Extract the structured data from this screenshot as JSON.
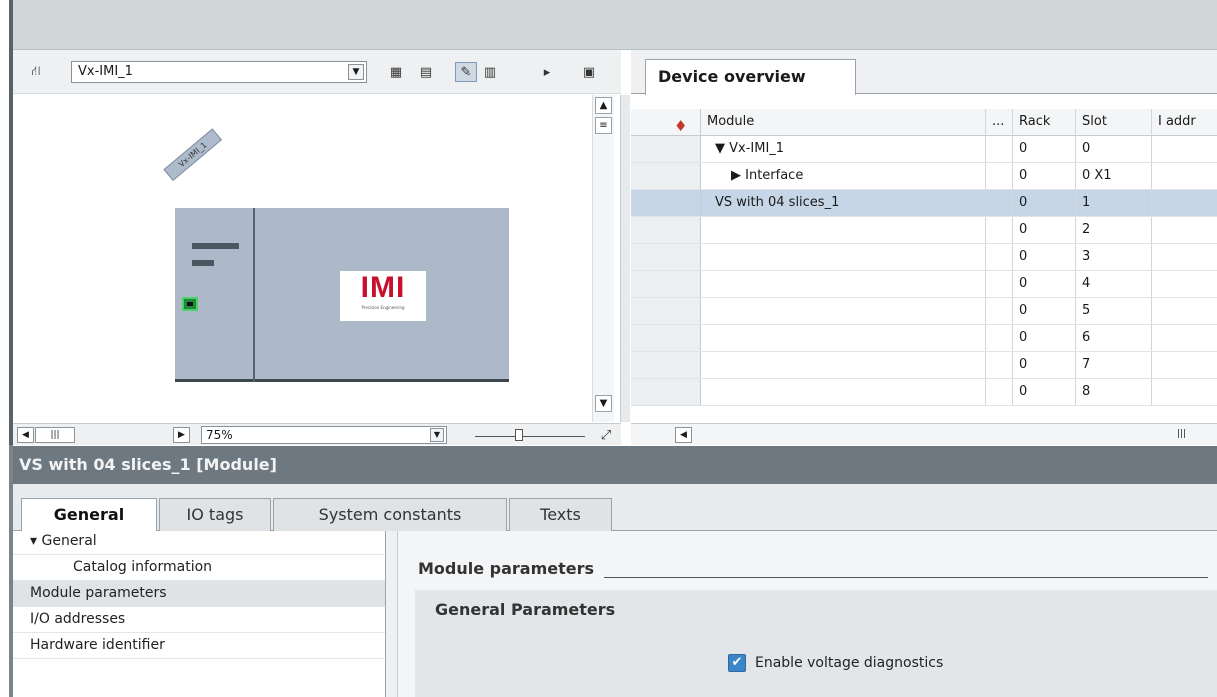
{
  "device_view": {
    "device_select": "Vx-IMI_1",
    "module_tag": "Vx-IMI_1",
    "logo_text": "IMI",
    "logo_subtext": "Precision Engineering",
    "zoom": "75%"
  },
  "device_overview": {
    "tab_label": "Device overview",
    "columns": [
      "Module",
      "...",
      "Rack",
      "Slot",
      "I addr"
    ],
    "rows": [
      {
        "module": "▼ Vx-IMI_1",
        "rack": "0",
        "slot": "0",
        "indent": 1
      },
      {
        "module": "▶ Interface",
        "rack": "0",
        "slot": "0 X1",
        "indent": 2
      },
      {
        "module": "VS with 04 slices_1",
        "rack": "0",
        "slot": "1",
        "indent": 1,
        "selected": true
      },
      {
        "module": "",
        "rack": "0",
        "slot": "2"
      },
      {
        "module": "",
        "rack": "0",
        "slot": "3"
      },
      {
        "module": "",
        "rack": "0",
        "slot": "4"
      },
      {
        "module": "",
        "rack": "0",
        "slot": "5"
      },
      {
        "module": "",
        "rack": "0",
        "slot": "6"
      },
      {
        "module": "",
        "rack": "0",
        "slot": "7"
      },
      {
        "module": "",
        "rack": "0",
        "slot": "8"
      }
    ]
  },
  "properties": {
    "title": "VS with 04 slices_1 [Module]",
    "tabs": [
      "General",
      "IO tags",
      "System constants",
      "Texts"
    ],
    "nav": [
      "General",
      "Catalog information",
      "Module parameters",
      "I/O addresses",
      "Hardware identifier"
    ],
    "section_title": "Module parameters",
    "group_title": "General Parameters",
    "checkbox_label": "Enable voltage diagnostics",
    "checkbox_checked": true
  }
}
